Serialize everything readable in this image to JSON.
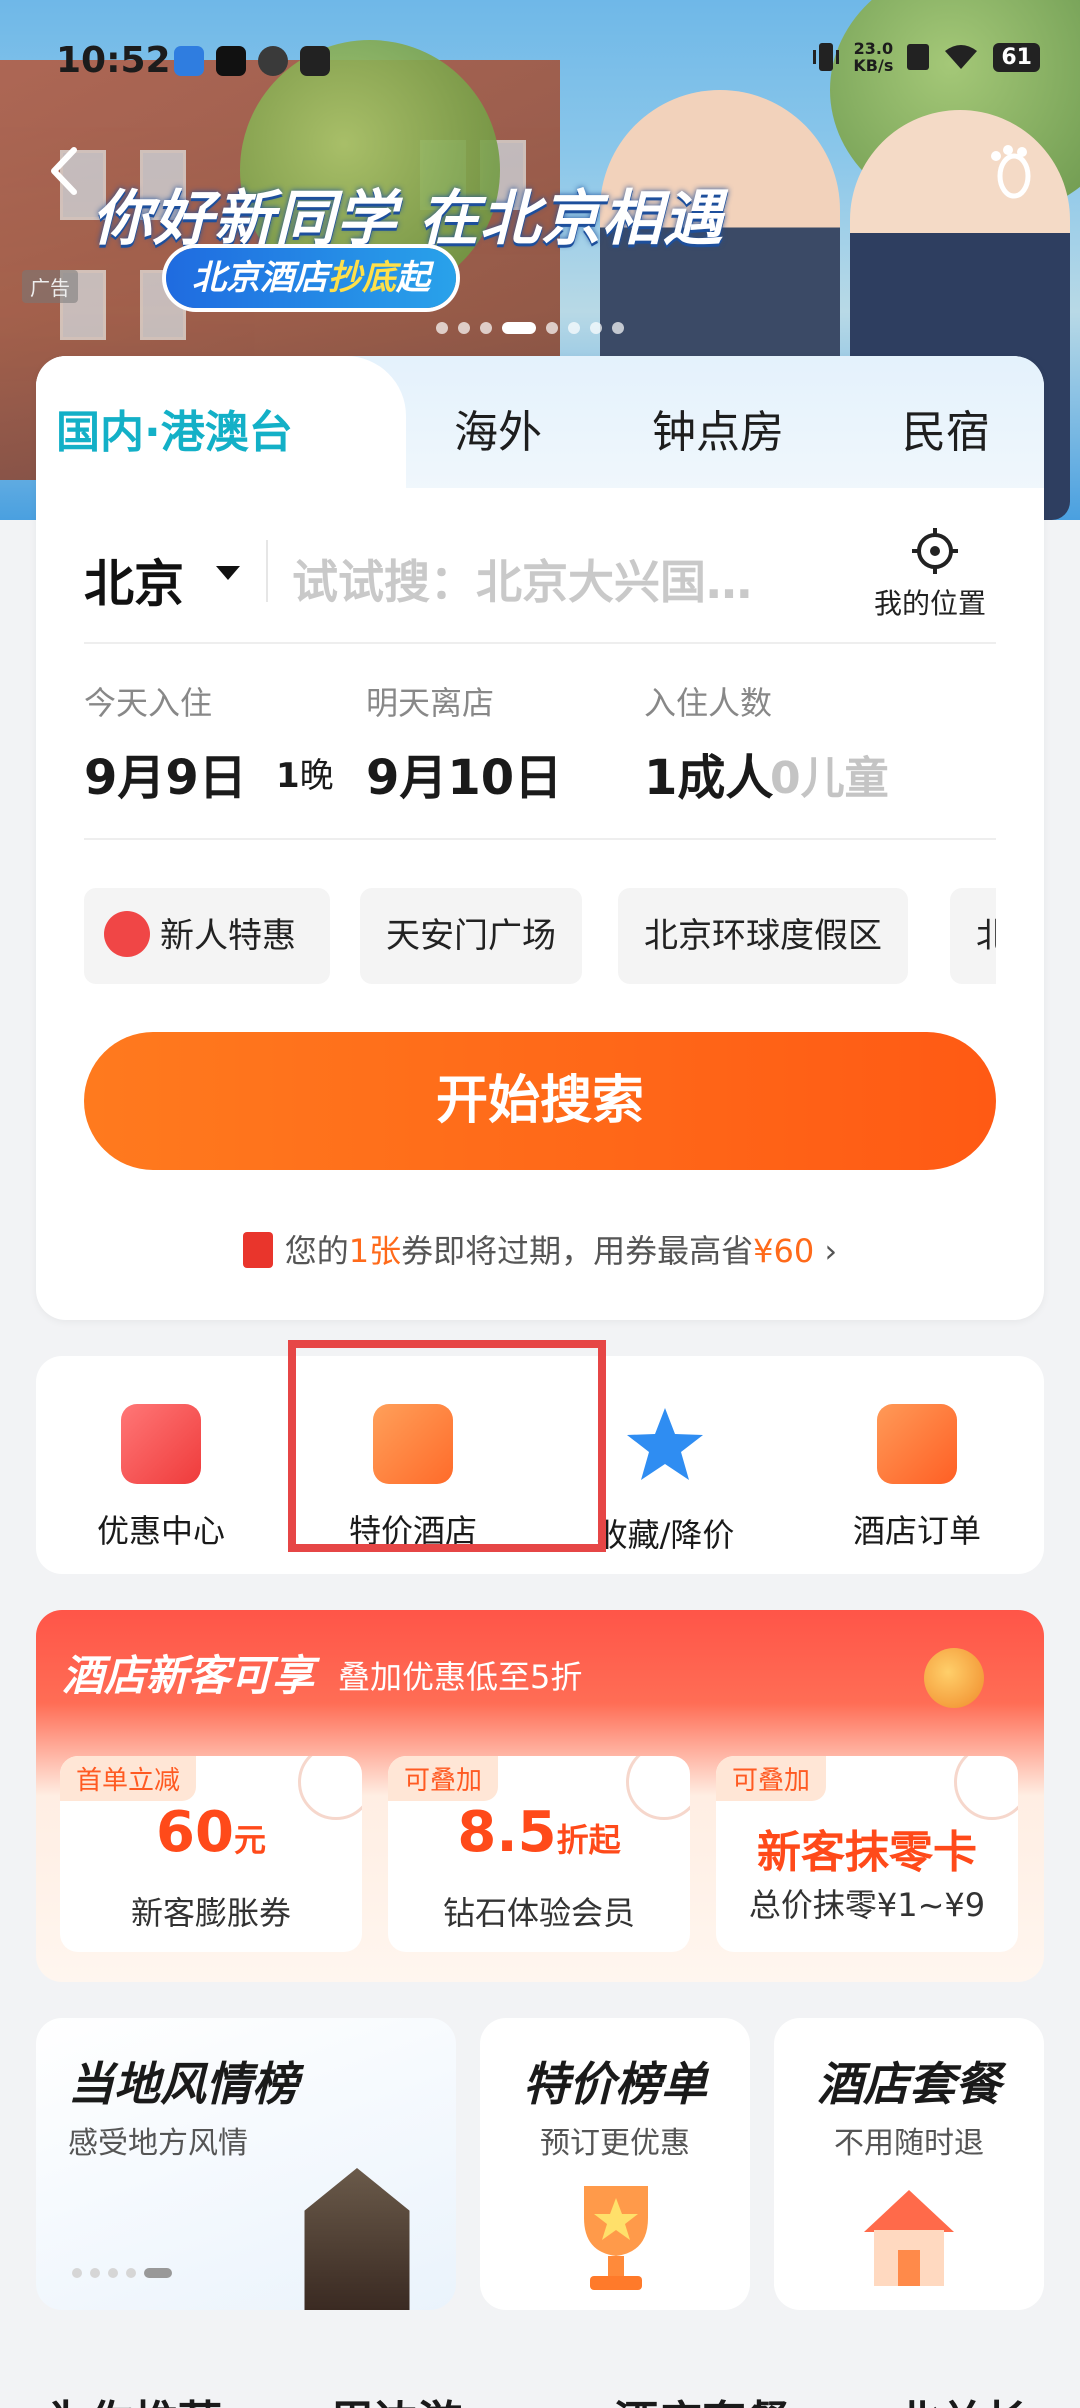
{
  "status_bar": {
    "time": "10:52",
    "net_speed_value": "23.0",
    "net_speed_unit": "KB/s",
    "battery": "61"
  },
  "banner": {
    "title": "你好新同学 在北京相遇",
    "subtitle_prefix": "北京酒店",
    "subtitle_highlight": "抄底",
    "subtitle_suffix": "起",
    "ad_tag": "广告",
    "slide_count": 8,
    "active_slide": 4
  },
  "tabs": [
    {
      "label": "国内·港澳台",
      "active": true
    },
    {
      "label": "海外",
      "active": false
    },
    {
      "label": "钟点房",
      "active": false
    },
    {
      "label": "民宿",
      "active": false
    }
  ],
  "search": {
    "city": "北京",
    "keyword_placeholder": "试试搜：北京大兴国…",
    "my_location": "我的位置",
    "checkin_label": "今天入住",
    "checkin_date": "9月9日",
    "nights_num": "1",
    "nights_unit": "晚",
    "checkout_label": "明天离店",
    "checkout_date": "9月10日",
    "guests_label": "入住人数",
    "adults": "1成人",
    "children": "0儿童",
    "chips": [
      "新人特惠",
      "天安门广场",
      "北京环球度假区",
      "北"
    ],
    "button": "开始搜索",
    "coupon_pre": "您的",
    "coupon_count": "1张",
    "coupon_mid": "券即将过期，用券最高省",
    "coupon_amount": "¥60"
  },
  "quick_menu": [
    {
      "label": "优惠中心",
      "icon": "coupon-icon",
      "color": "#f54b4b"
    },
    {
      "label": "特价酒店",
      "icon": "discount-hotel-icon",
      "color": "#ff7a2a"
    },
    {
      "label": "收藏/降价",
      "icon": "star-icon",
      "color": "#2f8df2"
    },
    {
      "label": "酒店订单",
      "icon": "order-icon",
      "color": "#ff6a2a"
    }
  ],
  "promo": {
    "title": "酒店新客可享",
    "subtitle": "叠加优惠低至5折",
    "cards": [
      {
        "badge": "首单立减",
        "amount": "60",
        "unit": "元",
        "desc": "新客膨胀券"
      },
      {
        "badge": "可叠加",
        "amount": "8.5",
        "unit": "折起",
        "desc": "钻石体验会员"
      },
      {
        "badge": "可叠加",
        "amount": "新客抹零卡",
        "unit": "",
        "desc": "总价抹零¥1~¥9"
      }
    ]
  },
  "tiles": [
    {
      "title": "当地风情榜",
      "sub": "感受地方风情"
    },
    {
      "title": "特价榜单",
      "sub": "预订更优惠"
    },
    {
      "title": "酒店套餐",
      "sub": "不用随时退"
    }
  ],
  "bottom_tabs": [
    "为你推荐",
    "周边游",
    "酒店套餐",
    "北关长"
  ]
}
